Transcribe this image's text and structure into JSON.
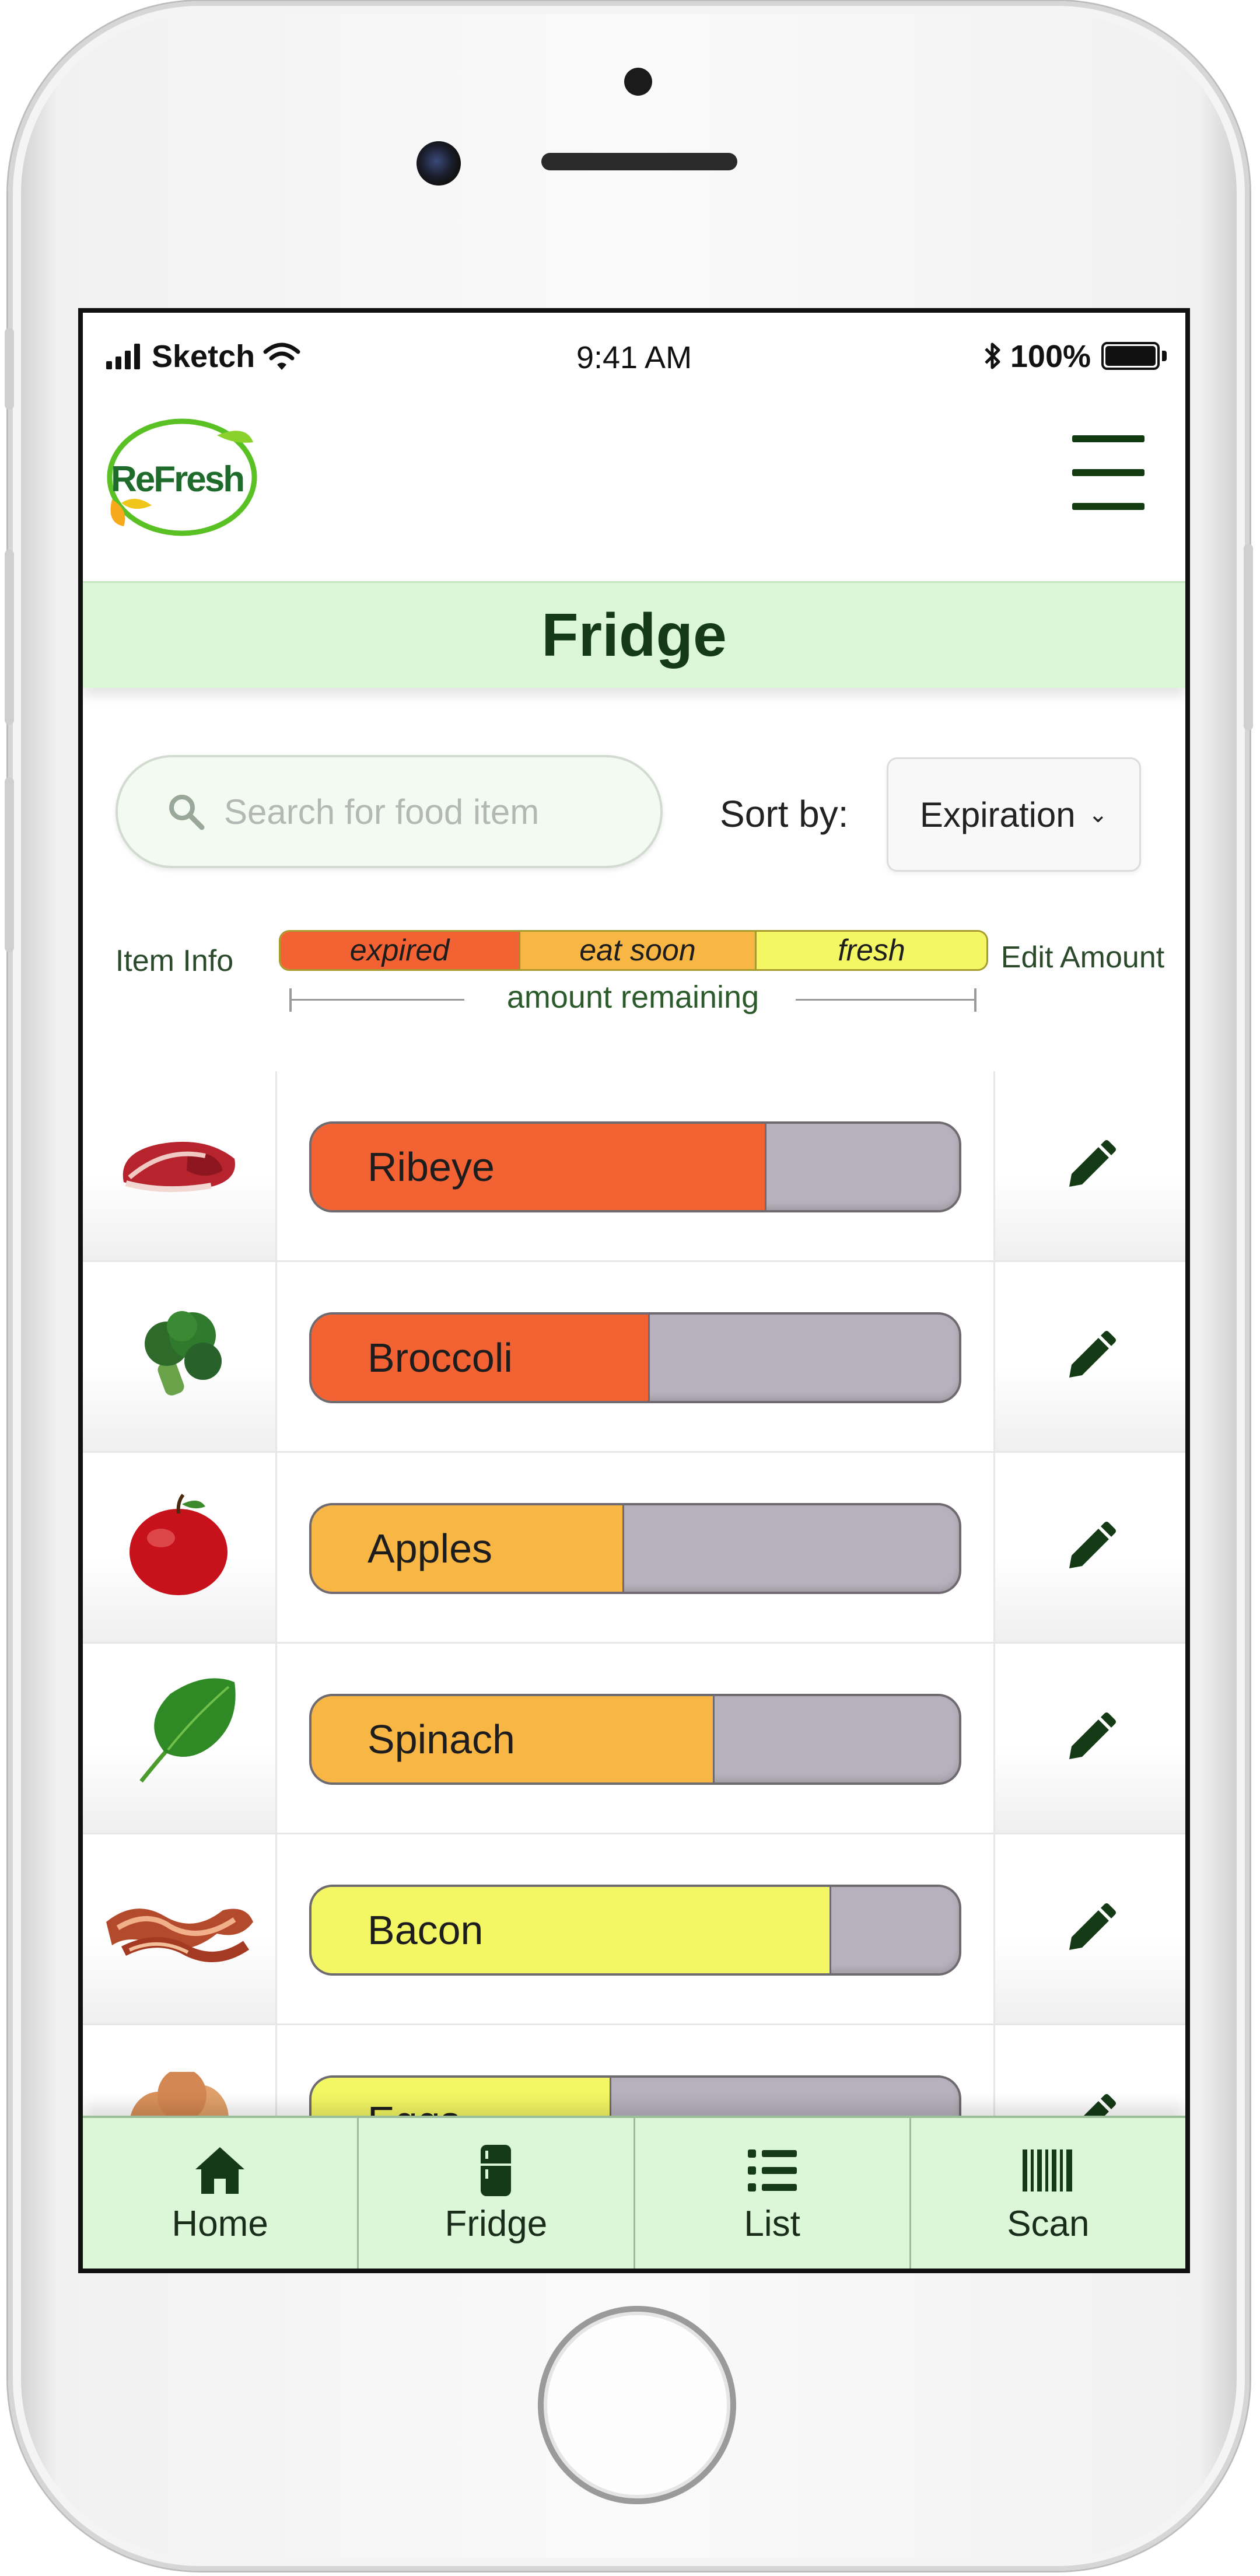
{
  "status_bar": {
    "carrier": "Sketch",
    "time": "9:41 AM",
    "battery": "100%"
  },
  "app": {
    "logo_text": "ReFresh"
  },
  "page": {
    "title": "Fridge"
  },
  "search": {
    "placeholder": "Search for food item",
    "value": ""
  },
  "sort": {
    "label": "Sort by:",
    "selected": "Expiration"
  },
  "columns": {
    "item_info": "Item Info",
    "edit_amount": "Edit Amount"
  },
  "legend": {
    "expired": "expired",
    "eat_soon": "eat soon",
    "fresh": "fresh",
    "amount_label": "amount remaining",
    "colors": {
      "expired": "#f26232",
      "eat_soon": "#f8b644",
      "fresh": "#f3f763"
    }
  },
  "items": [
    {
      "name": "Ribeye",
      "status": "expired",
      "amount_remaining": 0.7,
      "image": "steak"
    },
    {
      "name": "Broccoli",
      "status": "expired",
      "amount_remaining": 0.52,
      "image": "broccoli"
    },
    {
      "name": "Apples",
      "status": "eat soon",
      "amount_remaining": 0.48,
      "image": "apple"
    },
    {
      "name": "Spinach",
      "status": "eat soon",
      "amount_remaining": 0.62,
      "image": "spinach"
    },
    {
      "name": "Bacon",
      "status": "fresh",
      "amount_remaining": 0.8,
      "image": "bacon"
    },
    {
      "name": "Eggs",
      "status": "fresh",
      "amount_remaining": 0.46,
      "image": "eggs"
    }
  ],
  "nav": [
    {
      "label": "Home",
      "icon": "home-icon"
    },
    {
      "label": "Fridge",
      "icon": "fridge-icon"
    },
    {
      "label": "List",
      "icon": "list-icon"
    },
    {
      "label": "Scan",
      "icon": "barcode-icon"
    }
  ]
}
